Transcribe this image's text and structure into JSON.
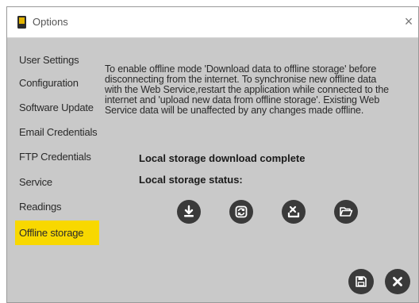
{
  "window": {
    "title": "Options",
    "close_glyph": "×"
  },
  "sidebar": {
    "items": [
      {
        "label": "User Settings"
      },
      {
        "label": "Configuration"
      },
      {
        "label": "Software Update"
      },
      {
        "label": "Email Credentials"
      },
      {
        "label": "FTP Credentials"
      },
      {
        "label": "Service"
      },
      {
        "label": "Readings"
      },
      {
        "label": "Offline storage",
        "active": true
      }
    ]
  },
  "main": {
    "info_lines": [
      "To enable offline mode 'Download data to offline storage' before",
      "disconnecting from the internet. To synchronise new offline data",
      "with the Web Service,restart the application while connected to the",
      "internet and 'upload new data from offline storage'. Existing Web",
      "Service data will be unaffected by any changes made offline."
    ],
    "download_status": "Local storage download complete",
    "storage_status_label": "Local storage status:",
    "actions": [
      {
        "icon": "download-icon"
      },
      {
        "icon": "sync-icon"
      },
      {
        "icon": "clear-storage-icon"
      },
      {
        "icon": "folder-open-icon"
      }
    ]
  },
  "footer": {
    "save_icon": "save-icon",
    "close_icon": "close-icon"
  },
  "colors": {
    "background": "#c9c9c9",
    "active_highlight": "#f8d800",
    "button": "#3a3a3a"
  }
}
